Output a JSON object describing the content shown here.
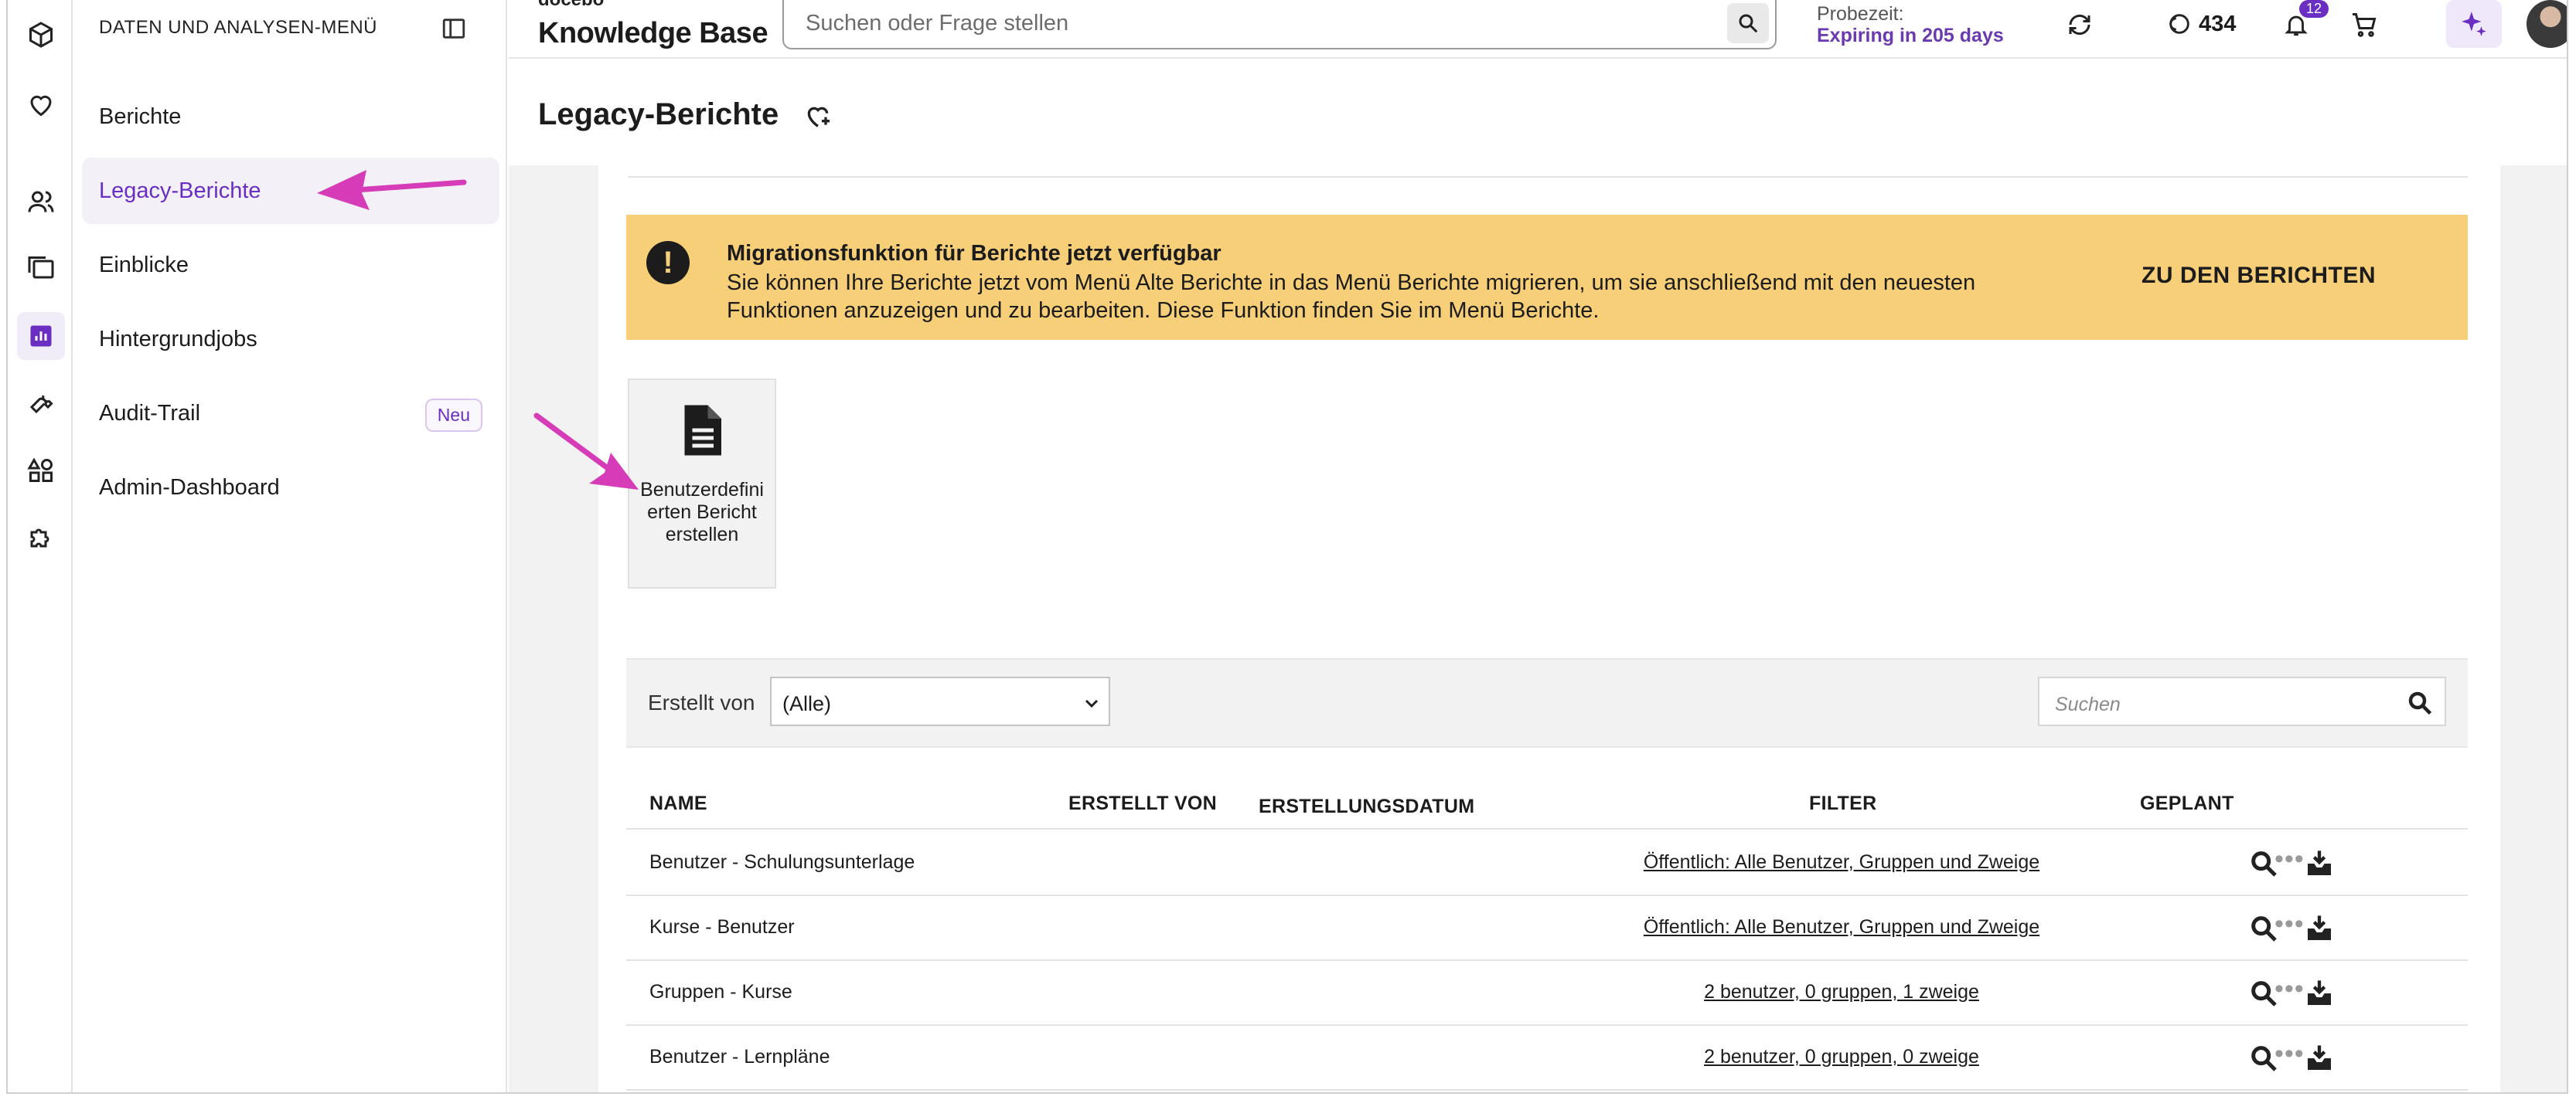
{
  "sidebar": {
    "title": "DATEN UND ANALYSEN-MENÜ",
    "items": [
      {
        "label": "Berichte"
      },
      {
        "label": "Legacy-Berichte"
      },
      {
        "label": "Einblicke"
      },
      {
        "label": "Hintergrundjobs"
      },
      {
        "label": "Audit-Trail",
        "badge": "Neu"
      },
      {
        "label": "Admin-Dashboard"
      }
    ]
  },
  "rail": {
    "icons": [
      "cube-icon",
      "heart-icon",
      "users-icon",
      "folders-icon",
      "chart-icon",
      "wrench-icon",
      "shapes-icon",
      "puzzle-icon"
    ]
  },
  "header": {
    "logo_small": "docebo",
    "logo": "Knowledge Base",
    "search_placeholder": "Suchen oder Frage stellen",
    "trial_label": "Probezeit:",
    "trial_value": "Expiring in 205 days",
    "credits": "434",
    "notifications": "12"
  },
  "page": {
    "title": "Legacy-Berichte"
  },
  "banner": {
    "title": "Migrationsfunktion für Berichte jetzt verfügbar",
    "text": "Sie können Ihre Berichte jetzt vom Menü Alte Berichte in das Menü Berichte migrieren, um sie anschließend mit den neuesten Funktionen anzuzeigen und zu bearbeiten. Diese Funktion finden Sie im Menü Berichte.",
    "link": "ZU DEN BERICHTEN"
  },
  "tile": {
    "label": "Benutzerdefinierten Bericht erstellen"
  },
  "filter": {
    "label": "Erstellt von",
    "selected": "(Alle)",
    "search_placeholder": "Suchen"
  },
  "table": {
    "columns": [
      "NAME",
      "ERSTELLT VON",
      "ERSTELLUNGSDATUM",
      "FILTER",
      "GEPLANT"
    ],
    "rows": [
      {
        "name": "Benutzer - Schulungsunterlage",
        "filter": "Öffentlich: Alle Benutzer, Gruppen und Zweige"
      },
      {
        "name": "Kurse - Benutzer",
        "filter": "Öffentlich: Alle Benutzer, Gruppen und Zweige"
      },
      {
        "name": "Gruppen - Kurse",
        "filter": "2 benutzer, 0 gruppen, 1 zweige"
      },
      {
        "name": "Benutzer - Lernpläne",
        "filter": "2 benutzer, 0 gruppen, 0 zweige"
      }
    ],
    "more_label": "•••"
  },
  "colors": {
    "accent": "#6a2fc2",
    "banner": "#f7cf79",
    "arrow": "#d63bb8"
  }
}
